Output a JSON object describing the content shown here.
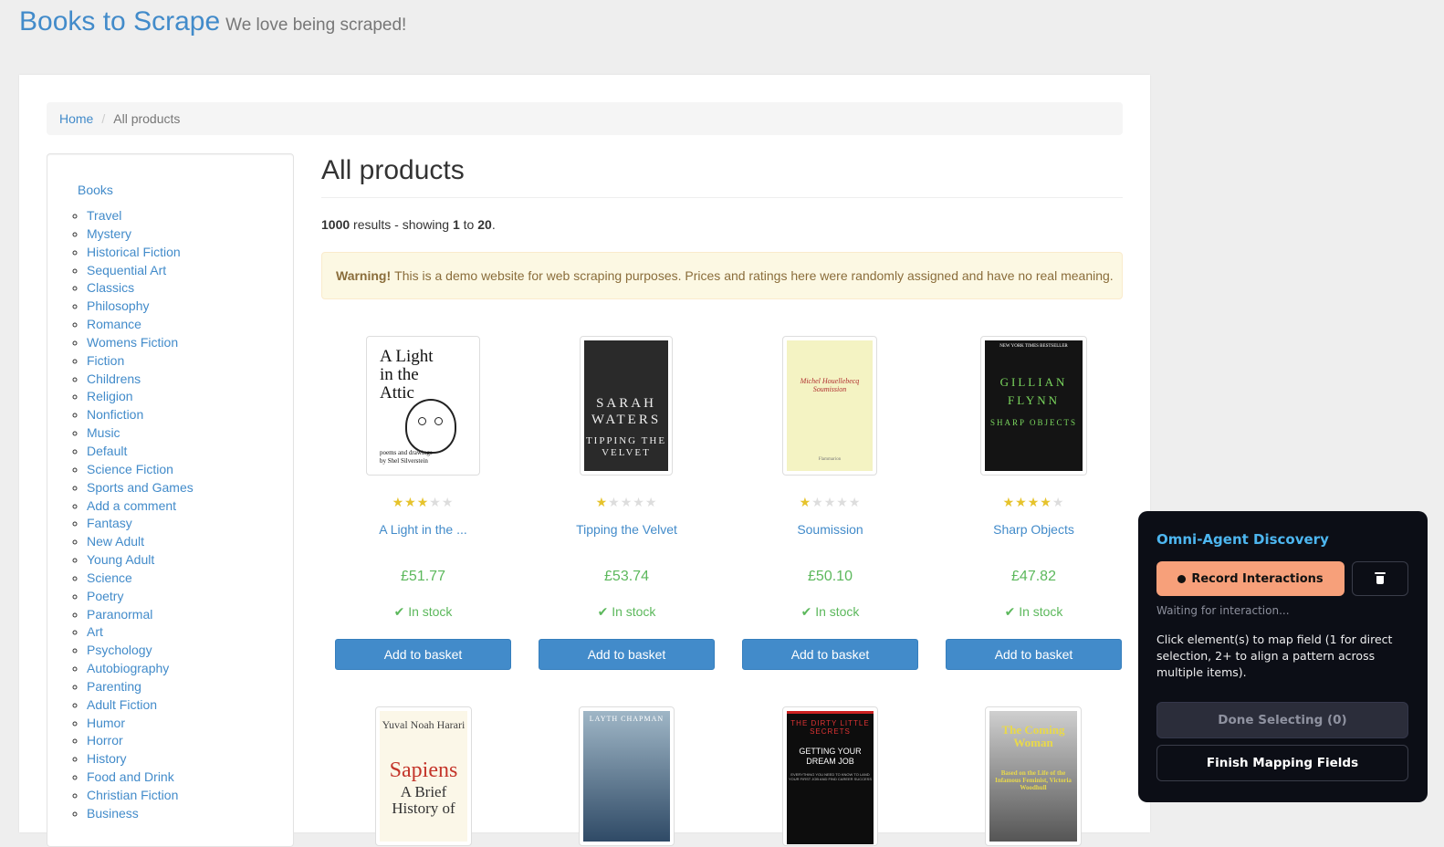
{
  "header": {
    "brand": "Books to Scrape",
    "tagline": "We love being scraped!"
  },
  "breadcrumb": {
    "home": "Home",
    "separator": "/",
    "current": "All products"
  },
  "sidebar": {
    "root": "Books",
    "categories": [
      "Travel",
      "Mystery",
      "Historical Fiction",
      "Sequential Art",
      "Classics",
      "Philosophy",
      "Romance",
      "Womens Fiction",
      "Fiction",
      "Childrens",
      "Religion",
      "Nonfiction",
      "Music",
      "Default",
      "Science Fiction",
      "Sports and Games",
      "Add a comment",
      "Fantasy",
      "New Adult",
      "Young Adult",
      "Science",
      "Poetry",
      "Paranormal",
      "Art",
      "Psychology",
      "Autobiography",
      "Parenting",
      "Adult Fiction",
      "Humor",
      "Horror",
      "History",
      "Food and Drink",
      "Christian Fiction",
      "Business"
    ]
  },
  "main": {
    "title": "All products",
    "results": {
      "total": "1000",
      "text1": " results - showing ",
      "from": "1",
      "text2": " to ",
      "to": "20",
      "text3": "."
    },
    "warning": {
      "label": "Warning!",
      "text": "This is a demo website for web scraping purposes. Prices and ratings here were randomly assigned and have no real meaning."
    }
  },
  "products": [
    {
      "title": "A Light in the ...",
      "price": "£51.77",
      "rating": 3,
      "stock": "In stock",
      "button": "Add to basket",
      "cover": {
        "title": "A Light in the Attic",
        "byline": "poems and drawings by Shel Silverstein"
      }
    },
    {
      "title": "Tipping the Velvet",
      "price": "£53.74",
      "rating": 1,
      "stock": "In stock",
      "button": "Add to basket",
      "cover": {
        "author": "SARAH WATERS",
        "title": "TIPPING THE VELVET"
      }
    },
    {
      "title": "Soumission",
      "price": "£50.10",
      "rating": 1,
      "stock": "In stock",
      "button": "Add to basket",
      "cover": {
        "title": "Michel Houellebecq Soumission",
        "publisher": "Flammarion"
      }
    },
    {
      "title": "Sharp Objects",
      "price": "£47.82",
      "rating": 4,
      "stock": "In stock",
      "button": "Add to basket",
      "cover": {
        "top": "NEW YORK TIMES BESTSELLER",
        "author": "GILLIAN FLYNN",
        "title": "SHARP OBJECTS"
      }
    }
  ],
  "products_row2": [
    {
      "cover": {
        "author": "Yuval Noah Harari",
        "title": "Sapiens",
        "subtitle": "A Brief History of"
      }
    },
    {
      "cover": {
        "author": "LAYTH CHAPMAN"
      }
    },
    {
      "cover": {
        "top": "THE DIRTY LITTLE SECRETS",
        "title": "GETTING YOUR DREAM JOB",
        "subtitle": "EVERYTHING YOU NEED TO KNOW TO LAND YOUR FIRST JOB AND FIND CAREER SUCCESS"
      }
    },
    {
      "cover": {
        "title": "The Coming Woman",
        "subtitle": "Based on the Life of the Infamous Feminist, Victoria Woodhull"
      }
    }
  ],
  "overlay": {
    "title": "Omni-Agent Discovery",
    "record_button": "Record Interactions",
    "status": "Waiting for interaction...",
    "instructions": "Click element(s) to map field (1 for direct selection, 2+ to align a pattern across multiple items).",
    "done_button": "Done Selecting (0)",
    "finish_button": "Finish Mapping Fields"
  },
  "icons": {
    "check": "check-icon",
    "star": "star-icon",
    "trash": "trash-icon",
    "record": "record-dot-icon"
  },
  "colors": {
    "link": "#428bca",
    "price": "#5cb85c",
    "star_on": "#e6c32c",
    "star_off": "#dddddd",
    "warning_bg": "#fcf8e3",
    "panel_bg": "#0c0e16",
    "panel_accent": "#4db6f0",
    "record_button": "#f7a07a"
  }
}
